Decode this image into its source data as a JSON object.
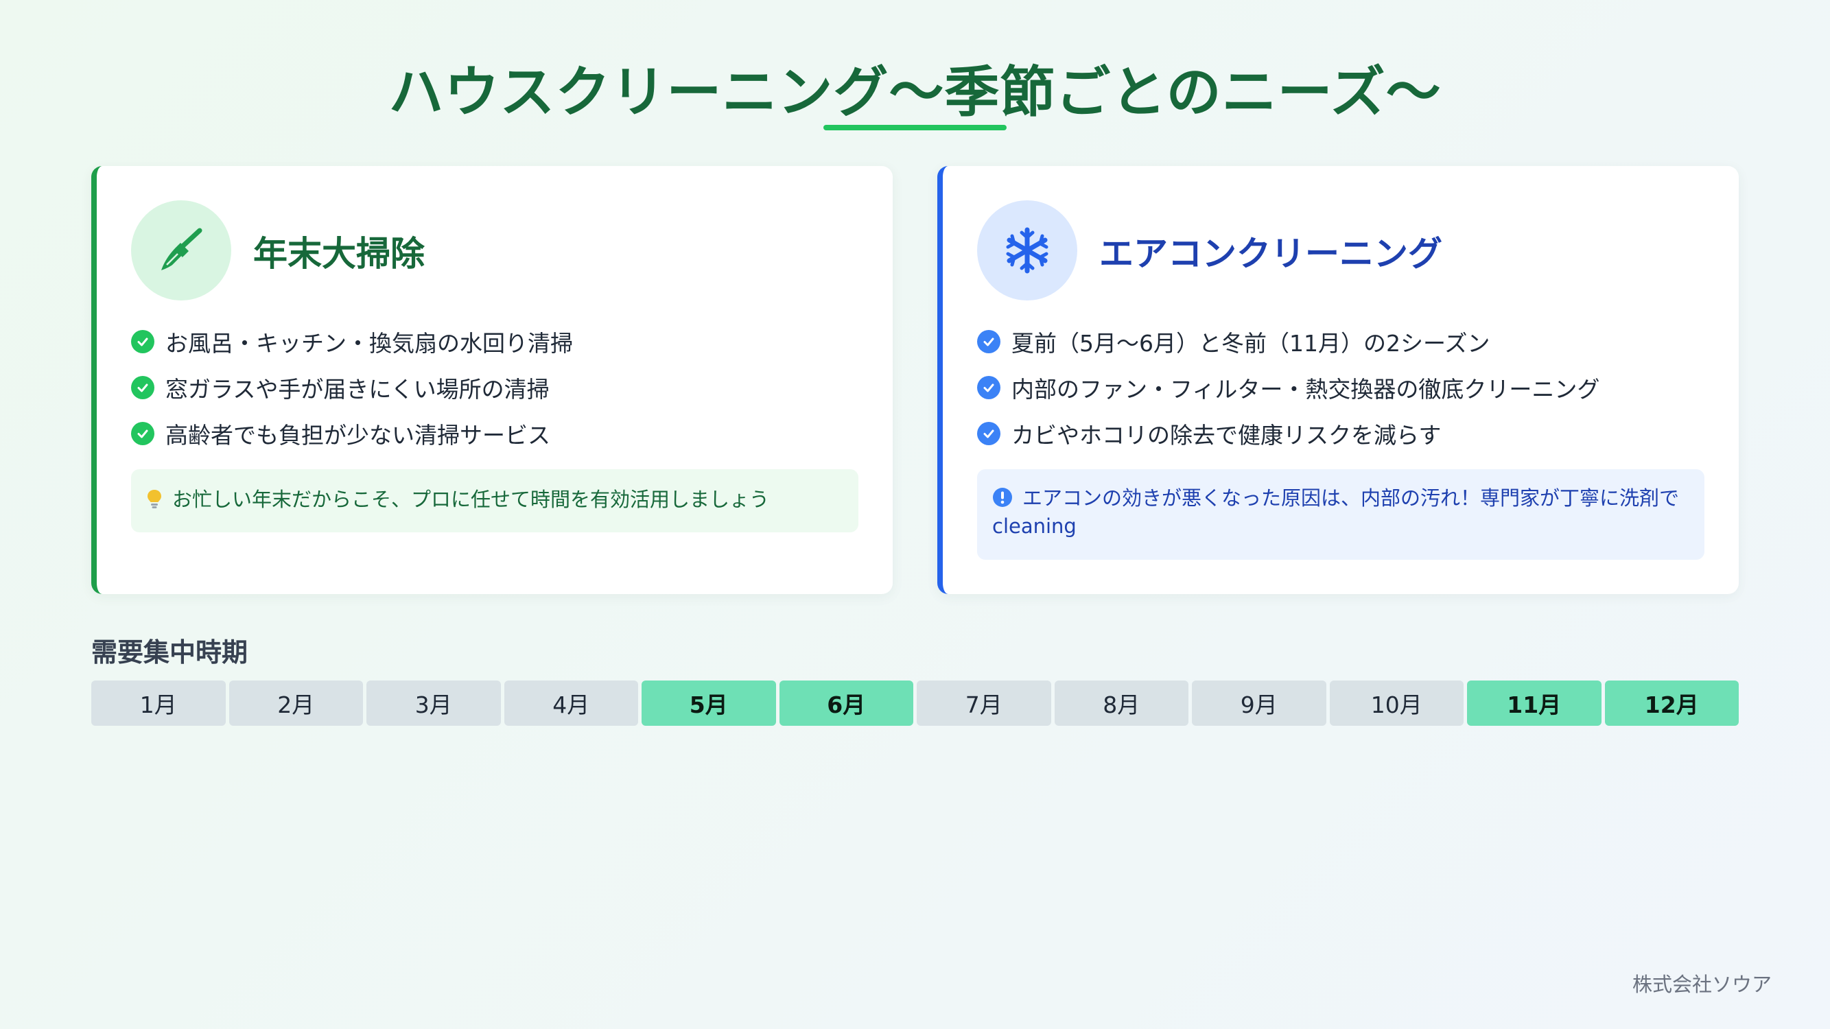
{
  "header": {
    "title": "ハウスクリーニング〜季節ごとのニーズ〜"
  },
  "cards": [
    {
      "title": "年末大掃除",
      "icon": "broom-icon",
      "accent": "#1e9e4a",
      "items": [
        "お風呂・キッチン・換気扇の水回り清掃",
        "窓ガラスや手が届きにくい場所の清掃",
        "高齢者でも負担が少ない清掃サービス"
      ],
      "note_icon": "lightbulb-icon",
      "note": "お忙しい年末だからこそ、プロに任せて時間を有効活用しましょう"
    },
    {
      "title": "エアコンクリーニング",
      "icon": "snowflake-icon",
      "accent": "#2563eb",
      "items": [
        "夏前（5月〜6月）と冬前（11月）の2シーズン",
        "内部のファン・フィルター・熱交換器の徹底クリーニング",
        "カビやホコリの除去で健康リスクを減らす"
      ],
      "note_icon": "exclamation-circle-icon",
      "note": "エアコンの効きが悪くなった原因は、内部の汚れ！専門家が丁寧に洗剤で cleaning"
    }
  ],
  "demand": {
    "label": "需要集中時期",
    "months": [
      {
        "label": "1月",
        "peak": false
      },
      {
        "label": "2月",
        "peak": false
      },
      {
        "label": "3月",
        "peak": false
      },
      {
        "label": "4月",
        "peak": false
      },
      {
        "label": "5月",
        "peak": true
      },
      {
        "label": "6月",
        "peak": true
      },
      {
        "label": "7月",
        "peak": false
      },
      {
        "label": "8月",
        "peak": false
      },
      {
        "label": "9月",
        "peak": false
      },
      {
        "label": "10月",
        "peak": false
      },
      {
        "label": "11月",
        "peak": true
      },
      {
        "label": "12月",
        "peak": true
      }
    ],
    "peak_color": "#6ee0b5"
  },
  "footer": {
    "company": "株式会社ソウア"
  }
}
